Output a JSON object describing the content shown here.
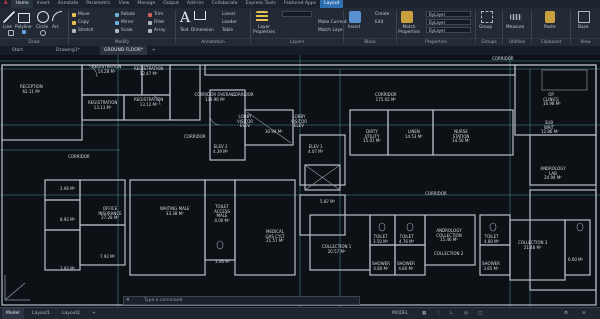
{
  "ribbon_tabs": [
    "Home",
    "Insert",
    "Annotate",
    "Parametric",
    "View",
    "Manage",
    "Output",
    "Add-ins",
    "Collaborate",
    "Express Tools",
    "Featured Apps",
    "Layout"
  ],
  "draw_tools": {
    "line": "Line",
    "polyline": "Polyline",
    "circle": "Circle",
    "arc": "Arc"
  },
  "modify_tools": {
    "move": "Move",
    "rotate": "Rotate",
    "trim": "Trim",
    "copy": "Copy",
    "mirror": "Mirror",
    "fillet": "Fillet",
    "stretch": "Stretch",
    "scale": "Scale",
    "array": "Array"
  },
  "annotation_tools": {
    "text": "Text",
    "dimension": "Dimension",
    "linear": "Linear",
    "leader": "Leader",
    "table": "Table"
  },
  "layer_tools": {
    "layer_properties": "Layer Properties",
    "make_current": "Make Current",
    "match_layer": "Match Layer"
  },
  "block_tools": {
    "insert": "Insert",
    "create": "Create",
    "edit": "Edit"
  },
  "properties_tools": {
    "match_properties": "Match Properties",
    "bylayer_color": "ByLayer",
    "bylayer_linetype": "ByLayer",
    "bylayer_lineweight": "ByLayer"
  },
  "groups_tools": {
    "group": "Group"
  },
  "utilities_tools": {
    "measure": "Measure"
  },
  "clipboard_tools": {
    "paste": "Paste"
  },
  "view_tools": {
    "base": "Base"
  },
  "panel_titles": {
    "draw": "Draw",
    "modify": "Modify",
    "annotation": "Annotation",
    "layers": "Layers",
    "block": "Block",
    "properties": "Properties",
    "groups": "Groups",
    "utilities": "Utilities",
    "clipboard": "Clipboard",
    "view": "View"
  },
  "doc_tabs": {
    "start": "Start",
    "drawing": "Drawing1*",
    "ground_floor": "GROUND FLOOR*"
  },
  "command_line": {
    "close": "✕",
    "placeholder": "Type a command"
  },
  "layout_tabs": {
    "model": "Model",
    "layout1": "Layout1",
    "layout2": "Layout2"
  },
  "status_model": "MODEL",
  "rooms": [
    {
      "name": "RECEPTION",
      "area": "62.11 M²"
    },
    {
      "name": "REGISTRATION",
      "area": "14.28 M²"
    },
    {
      "name": "REGISTRATION",
      "area": "12.47 M²"
    },
    {
      "name": "REGISTRATION",
      "area": "13.13 M²"
    },
    {
      "name": "REGISTRATION",
      "area": "13.12 M²"
    },
    {
      "name": "CORRIDOR OVERALL",
      "area": "139.96 M²"
    },
    {
      "name": "CORRIDOR",
      "area": ""
    },
    {
      "name": "CORRIDOR",
      "area": "175.02 M²"
    },
    {
      "name": "CORRIDOR",
      "area": ""
    },
    {
      "name": "LOBBY VISITOR ELEV",
      "area": ""
    },
    {
      "name": "LOBBY VISITOR ELEV",
      "area": ""
    },
    {
      "name": "",
      "area": "30.94 M²"
    },
    {
      "name": "ELEV 2",
      "area": "4.39 M²"
    },
    {
      "name": "ELEV 1",
      "area": "4.07 M²"
    },
    {
      "name": "DIRTY UTILITY",
      "area": "15.01 M²"
    },
    {
      "name": "LINEN",
      "area": "14.53 M²"
    },
    {
      "name": "NURSE STATION",
      "area": "14.50 M²"
    },
    {
      "name": "CORRIDOR",
      "area": ""
    },
    {
      "name": "",
      "area": "2.06 M²"
    },
    {
      "name": "OFFICE INSURANCE",
      "area": "27.28 M²"
    },
    {
      "name": "WAITING MALE",
      "area": "33.38 M²"
    },
    {
      "name": "TOILET ACCESS MALE",
      "area": "4.00 M²"
    },
    {
      "name": "MEDICAL GAS CYLT",
      "area": "21.57 M²"
    },
    {
      "name": "",
      "area": "5.87 M²"
    },
    {
      "name": "CORRIDOR",
      "area": ""
    },
    {
      "name": "",
      "area": "8.92 M²"
    },
    {
      "name": "",
      "area": "7.92 M²"
    },
    {
      "name": "",
      "area": "3.92 M²"
    },
    {
      "name": "",
      "area": "3.06 M²"
    },
    {
      "name": "COLLECTION 1",
      "area": "20.57 M²"
    },
    {
      "name": "TOILET",
      "area": "3.50 M²"
    },
    {
      "name": "TOILET",
      "area": "4.76 M²"
    },
    {
      "name": "ANDROLOGY COLLECTION",
      "area": "15.46 M²"
    },
    {
      "name": "TOILET",
      "area": "4.80 M²"
    },
    {
      "name": "SHOWER",
      "area": "4.80 M²"
    },
    {
      "name": "SHOWER",
      "area": "4.80 M²"
    },
    {
      "name": "COLLECTION 2",
      "area": ""
    },
    {
      "name": "SHOWER",
      "area": "3.85 M²"
    },
    {
      "name": "COLLECTION 3",
      "area": "21.48 M²"
    },
    {
      "name": "",
      "area": "6.60 M²"
    },
    {
      "name": "OP CLINICS",
      "area": "16.98 M²"
    },
    {
      "name": "SUB WAIT",
      "area": "12.86 M²"
    },
    {
      "name": "ANDROLOGY LAB",
      "area": "24.94 M²"
    },
    {
      "name": "CORRIDOR",
      "area": ""
    }
  ],
  "colors": {
    "ribbon_bg": "#232a35",
    "canvas_bg": "#0d1116",
    "wall": "#b8bec6",
    "dimension": "#5fb8c2",
    "accent": "#2f6fb0"
  }
}
